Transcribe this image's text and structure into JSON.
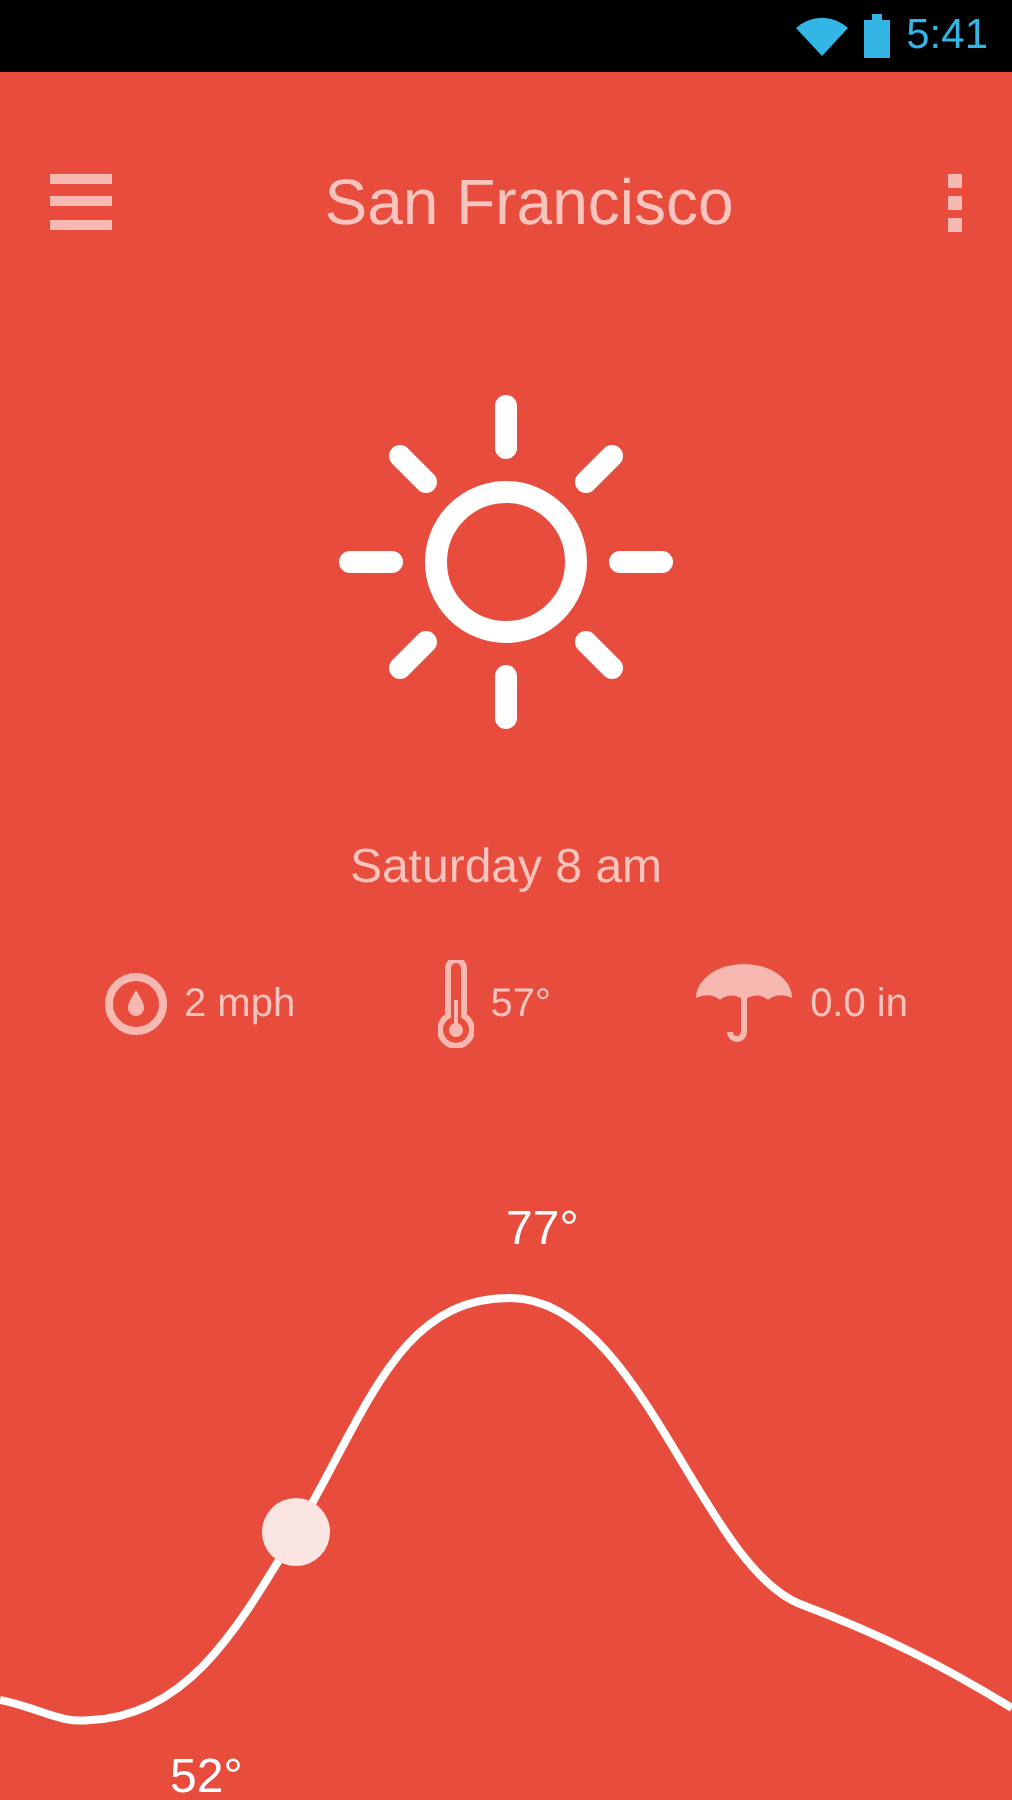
{
  "status_bar": {
    "time": "5:41"
  },
  "header": {
    "title": "San Francisco"
  },
  "forecast": {
    "day_time": "Saturday 8 am"
  },
  "stats": [
    {
      "kind": "wind",
      "value": "2 mph"
    },
    {
      "kind": "temperature",
      "value": "57°"
    },
    {
      "kind": "rain",
      "value": "0.0 in"
    }
  ],
  "temperature_curve": {
    "high_label": "77°",
    "low_label": "52°"
  }
}
